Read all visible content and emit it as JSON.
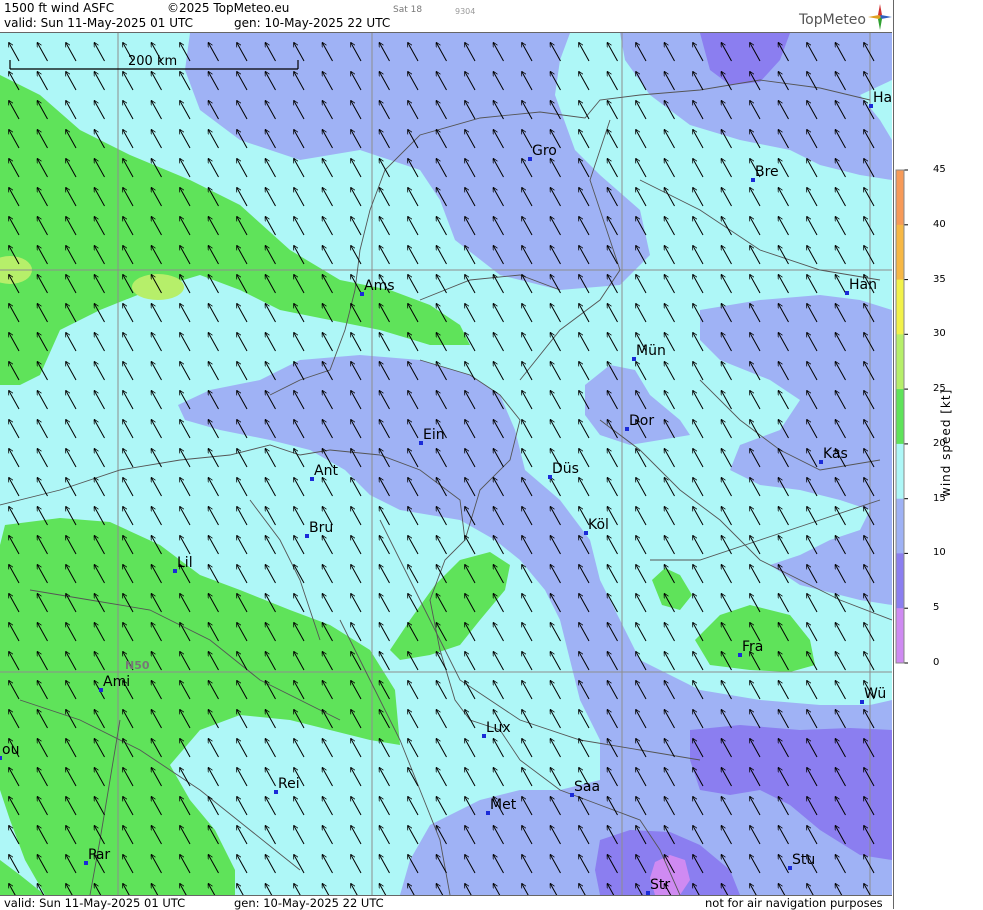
{
  "header": {
    "product": "1500 ft wind ASFC",
    "copyright": "©2025 TopMeteo.eu",
    "day": "Sat 18",
    "code": "9304",
    "valid": "valid:  Sun  11-May-2025  01 UTC",
    "gen": "gen: 10-May-2025 22 UTC",
    "logo": "TopMeteo"
  },
  "footer": {
    "valid": "valid:  Sun  11-May-2025  01 UTC",
    "gen": "gen: 10-May-2025 22 UTC",
    "disclaimer": "not for air navigation purposes"
  },
  "scale_bar": {
    "label": "200 km"
  },
  "lat_label": "N50",
  "legend": {
    "title": "wind speed [kt]",
    "ticks": [
      "45",
      "40",
      "35",
      "30",
      "25",
      "20",
      "15",
      "10",
      "5",
      "0"
    ],
    "colors": {
      "0": "#cf8af2",
      "5": "#8b7ef0",
      "10": "#9fb2f5",
      "15": "#aef7f7",
      "20": "#5fe35a",
      "25": "#b6ef6a",
      "30": "#f2f24a",
      "35": "#f7b845",
      "40": "#f79a58",
      "45": "#f27860"
    }
  },
  "cities": [
    {
      "name": "Gro"
    },
    {
      "name": "Bre"
    },
    {
      "name": "Ha"
    },
    {
      "name": "Ams"
    },
    {
      "name": "Han"
    },
    {
      "name": "Mün"
    },
    {
      "name": "Dor"
    },
    {
      "name": "Ein"
    },
    {
      "name": "Kas"
    },
    {
      "name": "Ant"
    },
    {
      "name": "Düs"
    },
    {
      "name": "Bru"
    },
    {
      "name": "Köl"
    },
    {
      "name": "Lil"
    },
    {
      "name": "Fra"
    },
    {
      "name": "Ami"
    },
    {
      "name": "Wü"
    },
    {
      "name": "ou"
    },
    {
      "name": "Lux"
    },
    {
      "name": "Rei"
    },
    {
      "name": "Saa"
    },
    {
      "name": "Met"
    },
    {
      "name": "Par"
    },
    {
      "name": "Stu"
    },
    {
      "name": "Str"
    }
  ]
}
